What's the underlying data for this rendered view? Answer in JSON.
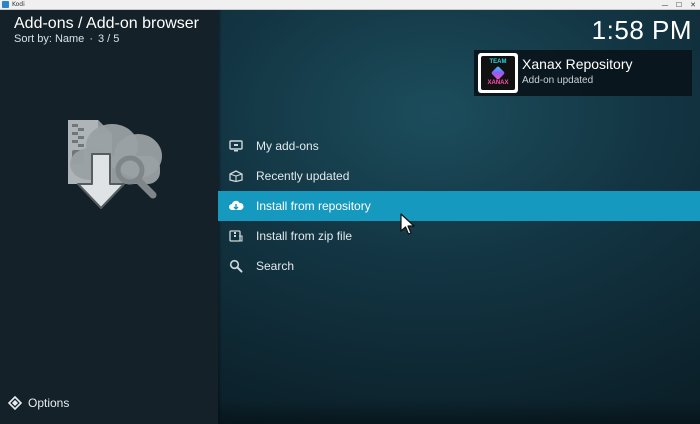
{
  "window": {
    "title": "Kodi",
    "controls": [
      "—",
      "☐",
      "✕"
    ]
  },
  "header": {
    "title": "Add-ons / Add-on browser",
    "sort_label": "Sort by: Name",
    "sort_separator": "·",
    "position": "3 / 5"
  },
  "clock": "1:58 PM",
  "notification": {
    "title": "Xanax Repository",
    "subtitle": "Add-on updated",
    "logo_text_top": "TEAM",
    "logo_text_bottom": "XANAX"
  },
  "menu": {
    "items": [
      {
        "label": "My add-ons",
        "icon": "monitor-icon",
        "active": false
      },
      {
        "label": "Recently updated",
        "icon": "box-icon",
        "active": false
      },
      {
        "label": "Install from repository",
        "icon": "cloud-download-icon",
        "active": true
      },
      {
        "label": "Install from zip file",
        "icon": "zip-icon",
        "active": false
      },
      {
        "label": "Search",
        "icon": "search-icon",
        "active": false
      }
    ]
  },
  "footer": {
    "options_label": "Options",
    "options_icon": "options-icon"
  },
  "colors": {
    "accent": "#1699bf",
    "left_panel": "#142128",
    "background": "#133543"
  }
}
